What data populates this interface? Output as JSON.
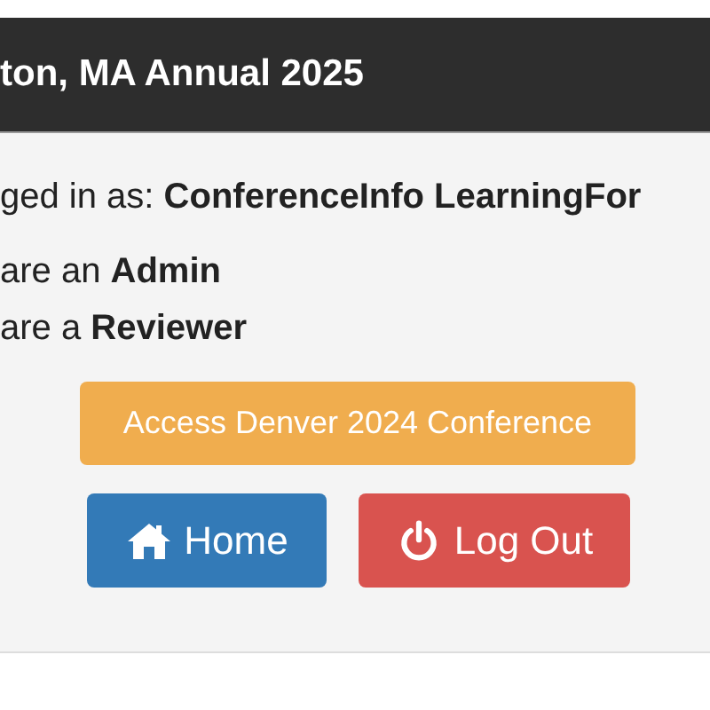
{
  "header": {
    "title": "ton, MA Annual 2025"
  },
  "lines": [
    "ged in as: **ConferenceInfo LearningFor**",
    "are an **Admin**",
    "are a **Reviewer**"
  ],
  "access_button": {
    "label": "Access Denver 2024 Conference",
    "kind": "warning"
  },
  "buttons": [
    {
      "label": "Home",
      "kind": "primary"
    },
    {
      "label": "Log Out",
      "kind": "danger"
    }
  ]
}
